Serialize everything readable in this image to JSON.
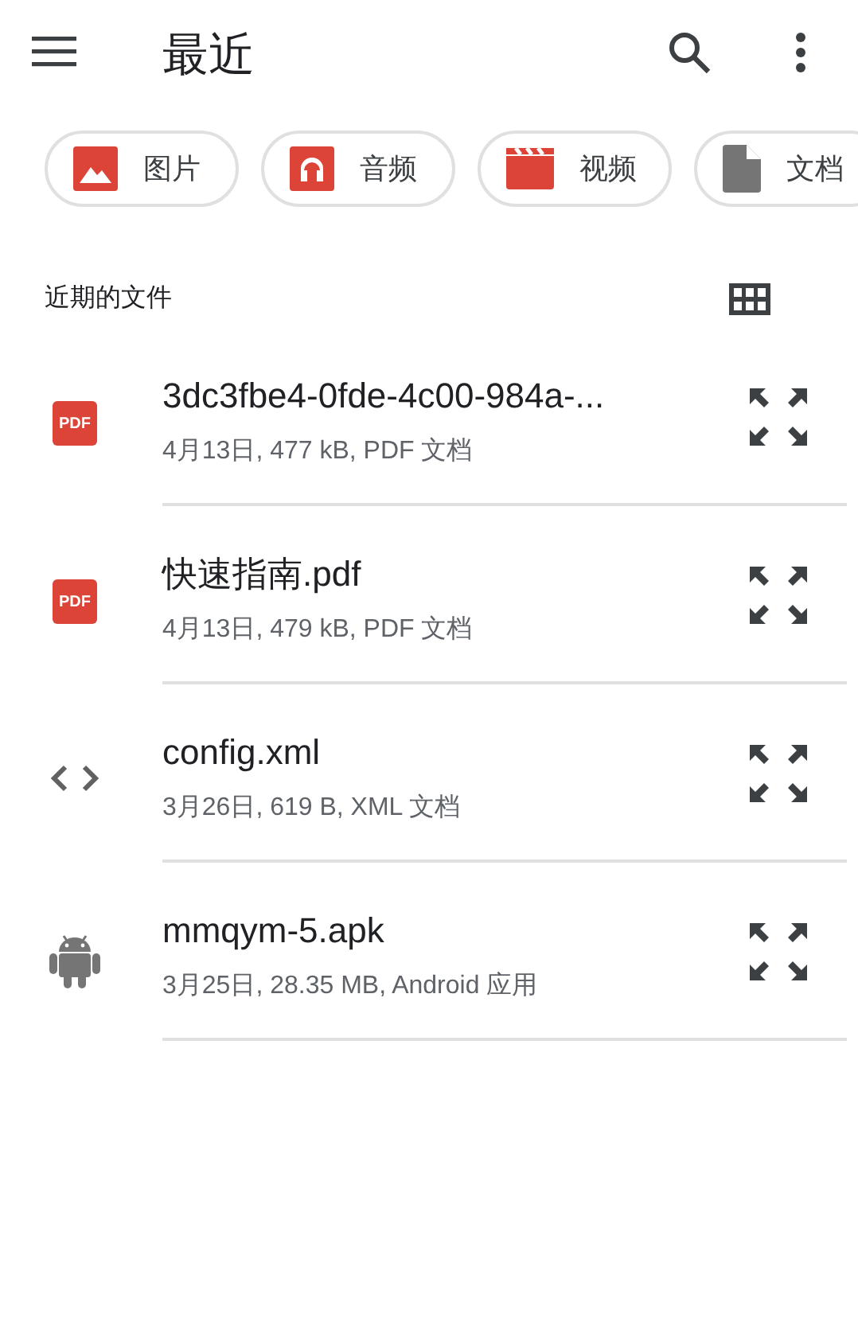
{
  "app_bar": {
    "title": "最近"
  },
  "chips": [
    {
      "kind": "image",
      "label": "图片"
    },
    {
      "kind": "audio",
      "label": "音频"
    },
    {
      "kind": "video",
      "label": "视频"
    },
    {
      "kind": "doc",
      "label": "文档"
    }
  ],
  "section": {
    "title": "近期的文件"
  },
  "files": [
    {
      "kind": "pdf",
      "badge": "PDF",
      "name": "3dc3fbe4-0fde-4c00-984a-...",
      "details": "4月13日, 477 kB, PDF 文档"
    },
    {
      "kind": "pdf",
      "badge": "PDF",
      "name": "快速指南.pdf",
      "details": "4月13日, 479 kB, PDF 文档"
    },
    {
      "kind": "code",
      "name": "config.xml",
      "details": "3月26日, 619 B, XML 文档"
    },
    {
      "kind": "android",
      "name": "mmqym-5.apk",
      "details": "3月25日, 28.35 MB, Android 应用"
    }
  ]
}
